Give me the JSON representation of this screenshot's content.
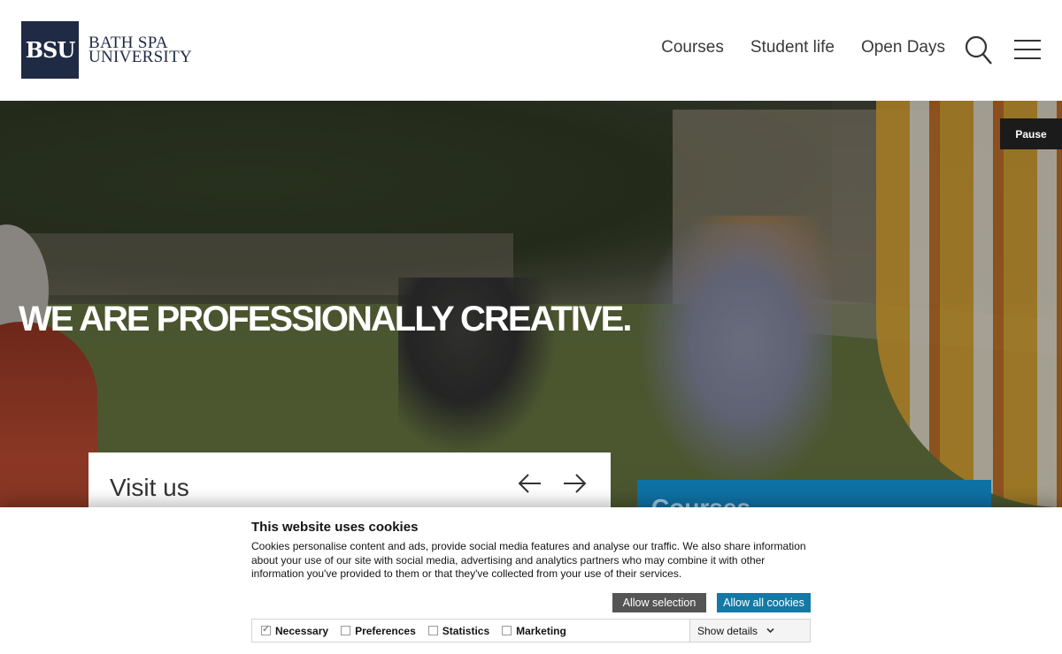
{
  "header": {
    "logo_mark": "BSU",
    "logo_line1": "BATH SPA",
    "logo_line2": "UNIVERSITY",
    "nav": [
      "Courses",
      "Student life",
      "Open Days"
    ]
  },
  "hero": {
    "pause_label": "Pause",
    "title": "WE ARE PROFESSIONALLY CREATIVE."
  },
  "visit_card": {
    "title": "Visit us"
  },
  "courses_card": {
    "title": "Courses"
  },
  "cookie_banner": {
    "title": "This website uses cookies",
    "text": "Cookies personalise content and ads, provide social media features and analyse our traffic. We also share information about your use of our site with social media, advertising and analytics partners who may combine it with other information you've provided to them or that they've collected from your use of their services.",
    "allow_selection": "Allow selection",
    "allow_all": "Allow all cookies",
    "options": [
      "Necessary",
      "Preferences",
      "Statistics",
      "Marketing"
    ],
    "show_details": "Show details"
  },
  "colors": {
    "brand_navy": "#1f2a44",
    "accent_blue": "#1479a6",
    "button_grey": "#555555"
  }
}
